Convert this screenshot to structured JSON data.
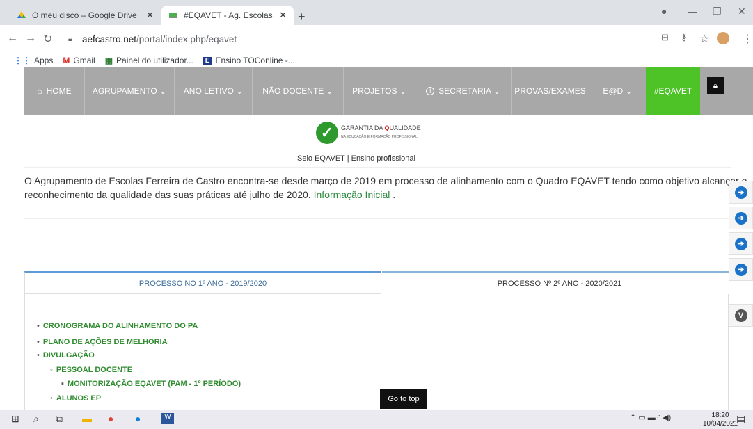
{
  "browser": {
    "tabs": [
      {
        "title": "O meu disco – Google Drive",
        "favicon": "google-drive-icon"
      },
      {
        "title": "#EQAVET - Ag. Escolas Ferreira d",
        "favicon": "site-favicon"
      }
    ],
    "new_tab": "+",
    "url_domain": "aefcastro.net",
    "url_path": "/portal/index.php/eqavet",
    "bookmarks": [
      {
        "label": "Apps",
        "icon": "apps-grid-icon"
      },
      {
        "label": "Gmail",
        "icon": "gmail-icon"
      },
      {
        "label": "Painel do utilizador...",
        "icon": "moodle-icon"
      },
      {
        "label": "Ensino TOConline -...",
        "icon": "toconline-icon"
      }
    ]
  },
  "nav": {
    "items": [
      {
        "label": "HOME"
      },
      {
        "label": "AGRUPAMENTO ⌄"
      },
      {
        "label": "ANO LETIVO ⌄"
      },
      {
        "label": "NÃO DOCENTE ⌄"
      },
      {
        "label": "PROJETOS ⌄"
      },
      {
        "label": "SECRETARIA ⌄"
      },
      {
        "label": "PROVAS/EXAMES"
      },
      {
        "label": "E@D ⌄"
      },
      {
        "label": "#EQAVET"
      }
    ],
    "active_color": "#4dc328"
  },
  "logo": {
    "line1a": "GARANTIA DA",
    "line1b": "UALIDADE",
    "line2": "NA EDUCAÇÃO E FORMAÇÃO PROFISSIONAL"
  },
  "caption": "Selo EQAVET | Ensino profissional",
  "intro": {
    "line1": "O Agrupamento de Escolas Ferreira de Castro encontra-se desde março de 2019 em processo de alinhamento com o Quadro EQAVET tendo como objetivo alcançar o",
    "line2_pre": "reconhecimento da qualidade das suas práticas até julho de 2020.",
    "line2_link": "Informação Inicial",
    "line2_post": "."
  },
  "process_tabs": [
    "PROCESSO NO 1º ANO - 2019/2020",
    "PROCESSO Nº 2º ANO - 2020/2021"
  ],
  "list": [
    "CRONOGRAMA DO ALINHAMENTO DO PA",
    "PLANO DE AÇÕES DE MELHORIA",
    "DIVULGAÇÃO",
    "PESSOAL DOCENTE",
    "MONITORIZAÇÃO EQAVET (PAM - 1º PERÍODO)",
    "ALUNOS EP"
  ],
  "go_to_top": "Go to top",
  "taskbar": {
    "time": "18:20",
    "date": "10/04/2021"
  }
}
